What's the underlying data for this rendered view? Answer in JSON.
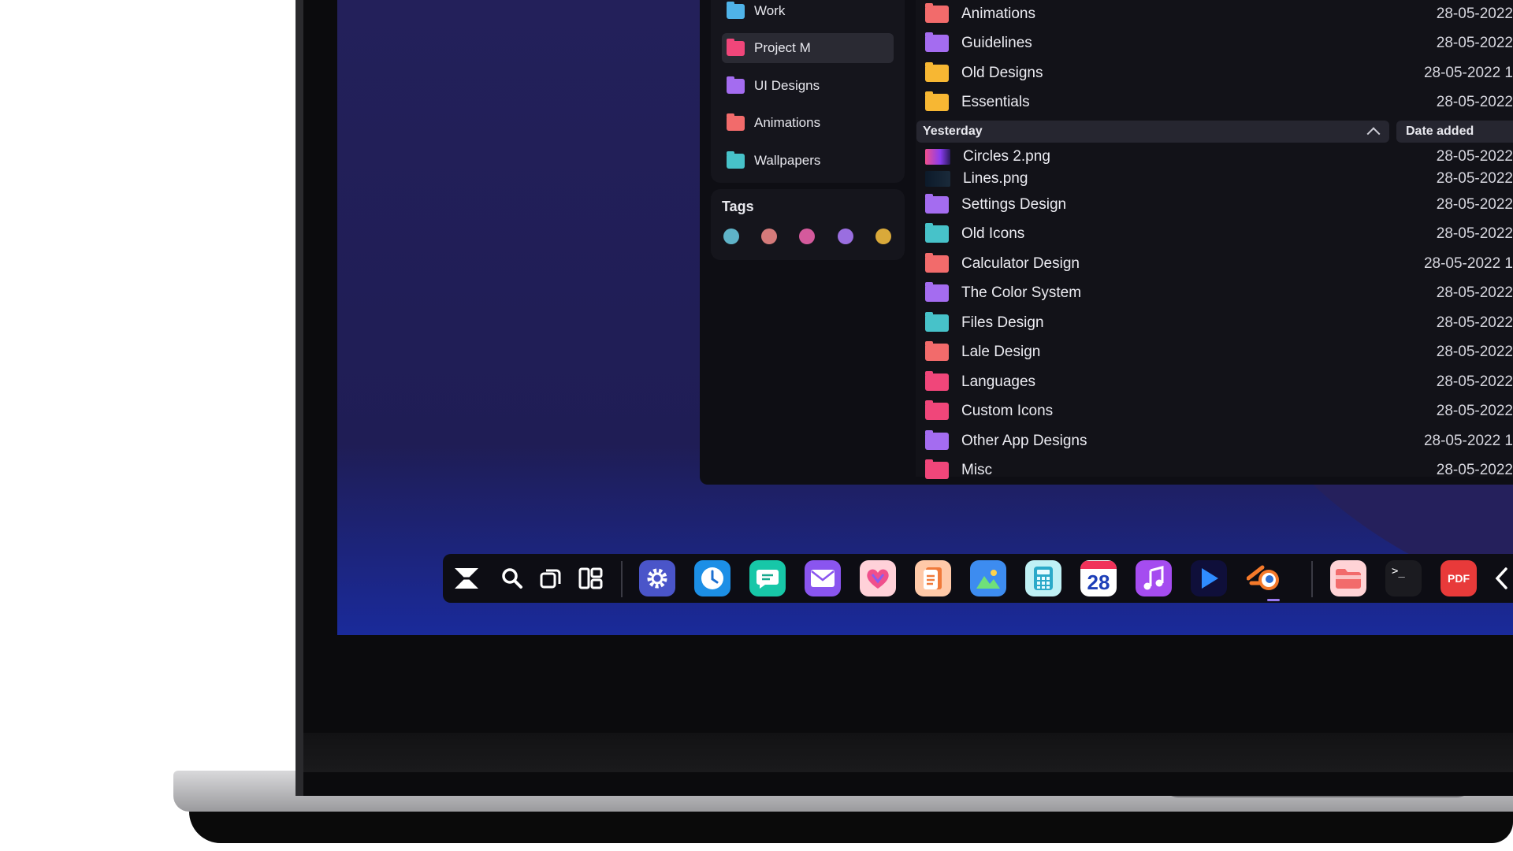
{
  "sidebar": {
    "folders": [
      {
        "label": "Work",
        "color": "#4fb3e8"
      },
      {
        "label": "Project M",
        "color": "#f0467a",
        "active": true
      },
      {
        "label": "UI Designs",
        "color": "#a46cf0"
      },
      {
        "label": "Animations",
        "color": "#f26b6b"
      },
      {
        "label": "Wallpapers",
        "color": "#47c2c9"
      }
    ],
    "tags_title": "Tags",
    "tags": [
      "#5fb3c8",
      "#d47a7a",
      "#d45a9c",
      "#9a6ee0",
      "#d9a93a"
    ]
  },
  "files": {
    "top_rows": [
      {
        "name": "Animations",
        "date": "28-05-2022",
        "color": "#f26b6b"
      },
      {
        "name": "Guidelines",
        "date": "28-05-2022",
        "color": "#a46cf0"
      },
      {
        "name": "Old Designs",
        "date": "28-05-2022 1",
        "color": "#f7b733"
      },
      {
        "name": "Essentials",
        "date": "28-05-2022",
        "color": "#f7b733"
      }
    ],
    "group_label": "Yesterday",
    "sort_label": "Date added",
    "yesterday_rows": [
      {
        "name": "Circles 2.png",
        "date": "28-05-2022",
        "thumb": true
      },
      {
        "name": "Lines.png",
        "date": "28-05-2022",
        "thumb": true
      },
      {
        "name": "Settings Design",
        "date": "28-05-2022",
        "color": "#a46cf0"
      },
      {
        "name": "Old Icons",
        "date": "28-05-2022",
        "color": "#47c2c9"
      },
      {
        "name": "Calculator Design",
        "date": "28-05-2022 1",
        "color": "#f26b6b"
      },
      {
        "name": "The Color System",
        "date": "28-05-2022",
        "color": "#a46cf0"
      },
      {
        "name": "Files Design",
        "date": "28-05-2022",
        "color": "#47c2c9"
      },
      {
        "name": "Lale Design",
        "date": "28-05-2022",
        "color": "#f26b6b"
      },
      {
        "name": "Languages",
        "date": "28-05-2022",
        "color": "#f0467a"
      },
      {
        "name": "Custom Icons",
        "date": "28-05-2022",
        "color": "#f0467a"
      },
      {
        "name": "Other App Designs",
        "date": "28-05-2022 1",
        "color": "#a46cf0"
      },
      {
        "name": "Misc",
        "date": "28-05-2022",
        "color": "#f0467a"
      }
    ]
  },
  "dock": {
    "calendar_day": "28",
    "pdf_label": "PDF",
    "terminal_prompt": ">_"
  }
}
